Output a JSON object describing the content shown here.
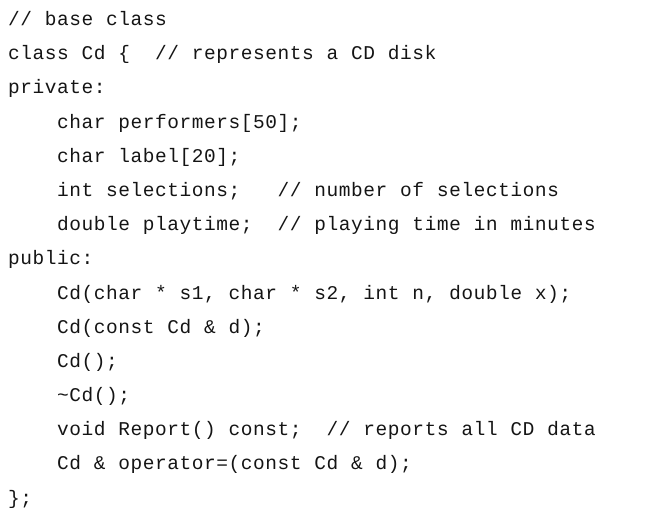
{
  "document": {
    "kind": "code-listing",
    "language": "C++",
    "background_color": "#ffffff",
    "text_color": "#141414"
  },
  "code": {
    "lines": [
      "// base class",
      "class Cd {  // represents a CD disk",
      "private:",
      "    char performers[50];",
      "    char label[20];",
      "    int selections;   // number of selections",
      "    double playtime;  // playing time in minutes",
      "public:",
      "    Cd(char * s1, char * s2, int n, double x);",
      "    Cd(const Cd & d);",
      "    Cd();",
      "    ~Cd();",
      "    void Report() const;  // reports all CD data",
      "    Cd & operator=(const Cd & d);",
      "};"
    ]
  }
}
